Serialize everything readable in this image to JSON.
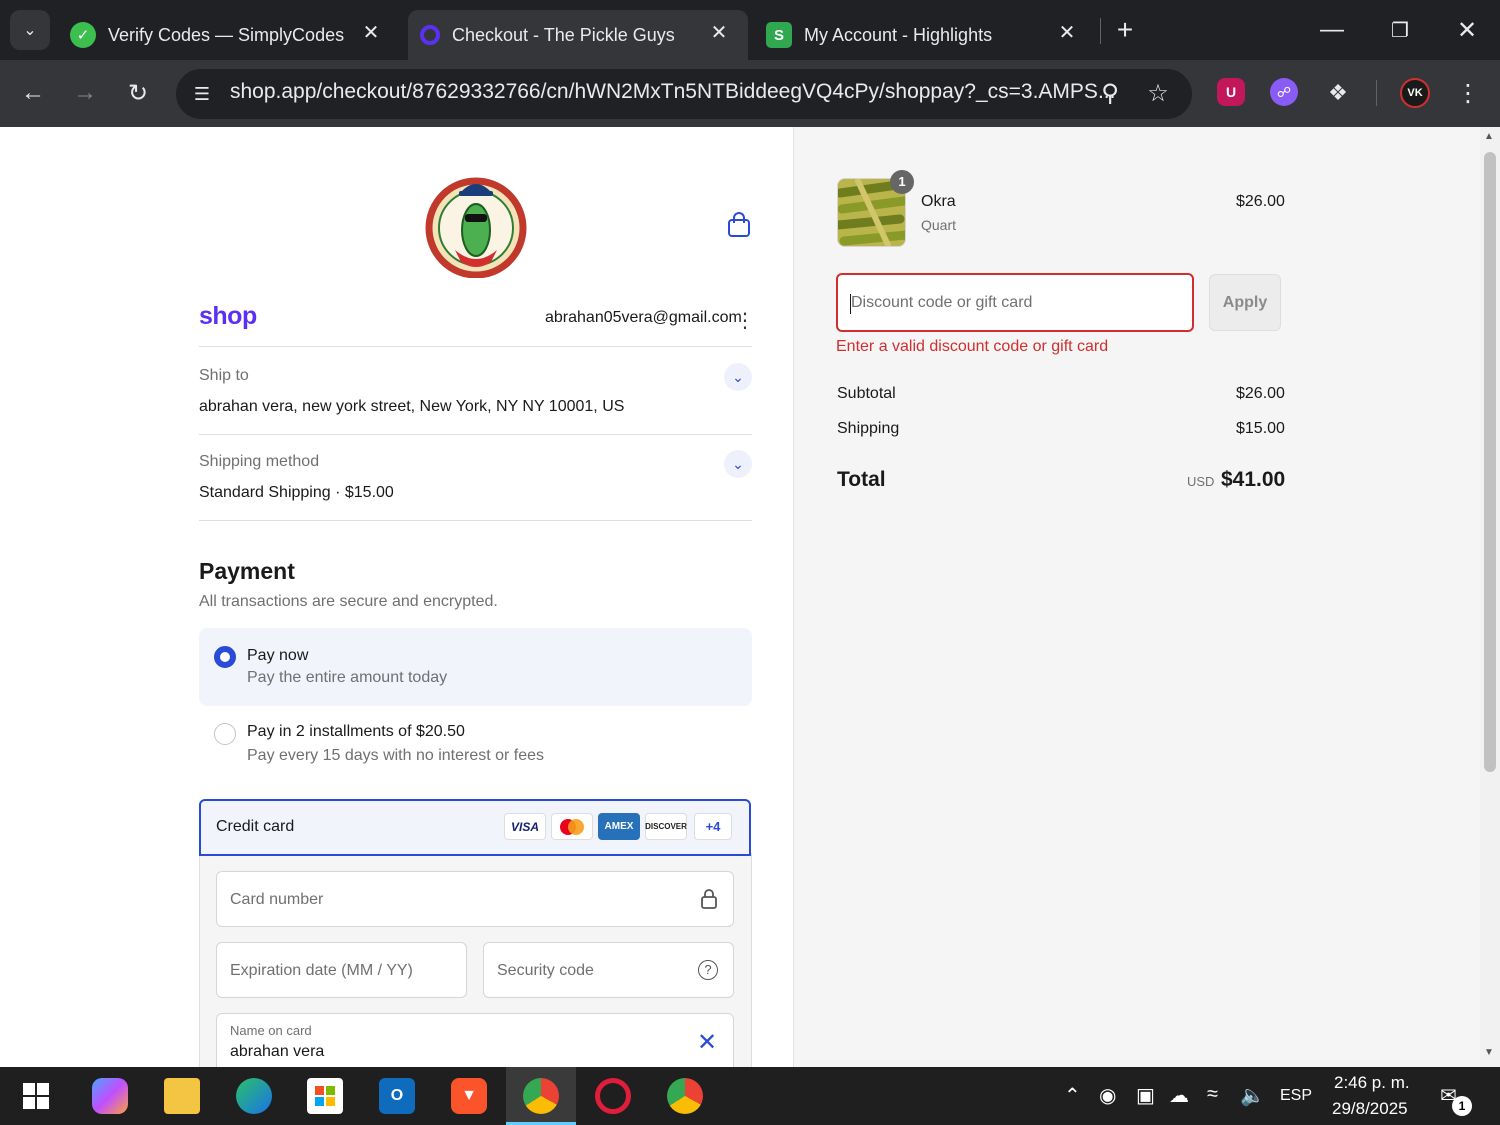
{
  "browser": {
    "tabs": [
      {
        "title": "Verify Codes — SimplyCodes",
        "favicon": "simplycodes-icon",
        "active": false
      },
      {
        "title": "Checkout - The Pickle Guys",
        "favicon": "shop-icon",
        "active": true
      },
      {
        "title": "My Account - Highlights",
        "favicon": "shopify-icon",
        "active": false
      }
    ],
    "url": "shop.app/checkout/87629332766/cn/hWN2MxTn5NTBiddeegVQ4cPy/shoppay?_cs=3.AMPS..."
  },
  "checkout": {
    "brand": "shop",
    "account_email": "abrahan05vera@gmail.com",
    "ship_to": {
      "label": "Ship to",
      "value": "abrahan vera, new york street, New York, NY NY 10001, US"
    },
    "shipping_method": {
      "label": "Shipping method",
      "value": "Standard Shipping · $15.00"
    },
    "payment": {
      "heading": "Payment",
      "subheading": "All transactions are secure and encrypted.",
      "options": [
        {
          "title": "Pay now",
          "subtitle": "Pay the entire amount today",
          "selected": true
        },
        {
          "title": "Pay in 2 installments of $20.50",
          "subtitle": "Pay every 15 days with no interest or fees",
          "selected": false
        }
      ],
      "method": {
        "label": "Credit card",
        "logos": [
          "VISA",
          "mastercard",
          "AMEX",
          "DISCOVER"
        ],
        "more": "+4"
      },
      "fields": {
        "card_number": "Card number",
        "expiration": "Expiration date (MM / YY)",
        "security_code": "Security code",
        "name_label": "Name on card",
        "name_value": "abrahan vera"
      }
    }
  },
  "summary": {
    "item": {
      "name": "Okra",
      "variant": "Quart",
      "price": "$26.00",
      "quantity": "1"
    },
    "discount": {
      "placeholder": "Discount code or gift card",
      "apply": "Apply",
      "error": "Enter a valid discount code or gift card"
    },
    "subtotal_label": "Subtotal",
    "subtotal": "$26.00",
    "shipping_label": "Shipping",
    "shipping": "$15.00",
    "total_label": "Total",
    "currency": "USD",
    "total": "$41.00"
  },
  "taskbar": {
    "language": "ESP",
    "time": "2:46 p. m.",
    "date": "29/8/2025",
    "notifications": "1"
  },
  "colors": {
    "shop_purple": "#5a31f4",
    "link_blue": "#2a4bd6",
    "error_red": "#d12e2e",
    "selected_bg": "#f2f4fc"
  }
}
